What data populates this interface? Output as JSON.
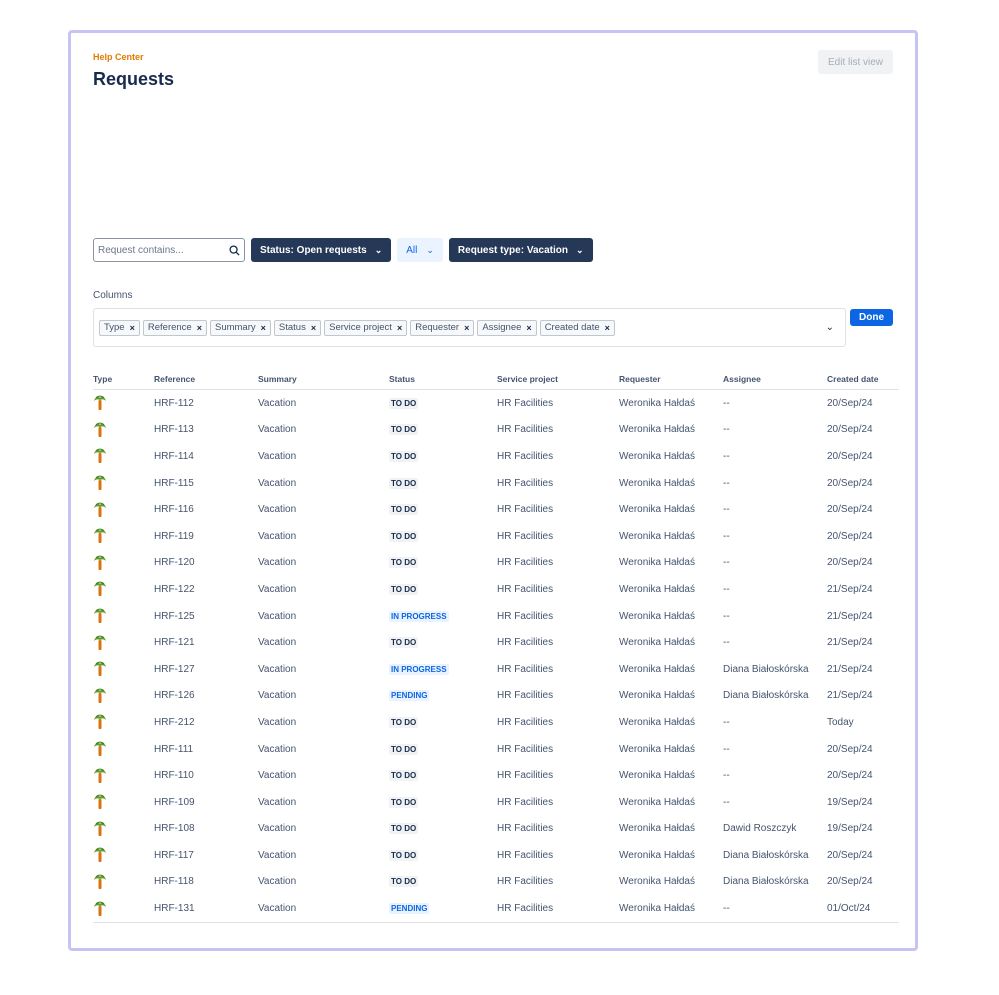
{
  "header": {
    "breadcrumb": "Help Center",
    "title": "Requests",
    "edit_button": "Edit list view"
  },
  "filters": {
    "search_placeholder": "Request contains...",
    "status_filter": "Status: Open requests",
    "all_filter": "All",
    "request_type_filter": "Request type: Vacation"
  },
  "columns_editor": {
    "label": "Columns",
    "tags": [
      "Type",
      "Reference",
      "Summary",
      "Status",
      "Service project",
      "Requester",
      "Assignee",
      "Created date"
    ],
    "done_button": "Done"
  },
  "table": {
    "headers": [
      "Type",
      "Reference",
      "Summary",
      "Status",
      "Service project",
      "Requester",
      "Assignee",
      "Created date"
    ],
    "rows": [
      {
        "type_icon": "palm-tree-icon",
        "reference": "HRF-112",
        "summary": "Vacation",
        "status": "TO DO",
        "project": "HR Facilities",
        "requester": "Weronika Hałdaś",
        "assignee": "--",
        "created": "20/Sep/24"
      },
      {
        "type_icon": "palm-tree-icon",
        "reference": "HRF-113",
        "summary": "Vacation",
        "status": "TO DO",
        "project": "HR Facilities",
        "requester": "Weronika Hałdaś",
        "assignee": "--",
        "created": "20/Sep/24"
      },
      {
        "type_icon": "palm-tree-icon",
        "reference": "HRF-114",
        "summary": "Vacation",
        "status": "TO DO",
        "project": "HR Facilities",
        "requester": "Weronika Hałdaś",
        "assignee": "--",
        "created": "20/Sep/24"
      },
      {
        "type_icon": "palm-tree-icon",
        "reference": "HRF-115",
        "summary": "Vacation",
        "status": "TO DO",
        "project": "HR Facilities",
        "requester": "Weronika Hałdaś",
        "assignee": "--",
        "created": "20/Sep/24"
      },
      {
        "type_icon": "palm-tree-icon",
        "reference": "HRF-116",
        "summary": "Vacation",
        "status": "TO DO",
        "project": "HR Facilities",
        "requester": "Weronika Hałdaś",
        "assignee": "--",
        "created": "20/Sep/24"
      },
      {
        "type_icon": "palm-tree-icon",
        "reference": "HRF-119",
        "summary": "Vacation",
        "status": "TO DO",
        "project": "HR Facilities",
        "requester": "Weronika Hałdaś",
        "assignee": "--",
        "created": "20/Sep/24"
      },
      {
        "type_icon": "palm-tree-icon",
        "reference": "HRF-120",
        "summary": "Vacation",
        "status": "TO DO",
        "project": "HR Facilities",
        "requester": "Weronika Hałdaś",
        "assignee": "--",
        "created": "20/Sep/24"
      },
      {
        "type_icon": "palm-tree-icon",
        "reference": "HRF-122",
        "summary": "Vacation",
        "status": "TO DO",
        "project": "HR Facilities",
        "requester": "Weronika Hałdaś",
        "assignee": "--",
        "created": "21/Sep/24"
      },
      {
        "type_icon": "palm-tree-icon",
        "reference": "HRF-125",
        "summary": "Vacation",
        "status": "IN PROGRESS",
        "project": "HR Facilities",
        "requester": "Weronika Hałdaś",
        "assignee": "--",
        "created": "21/Sep/24"
      },
      {
        "type_icon": "palm-tree-icon",
        "reference": "HRF-121",
        "summary": "Vacation",
        "status": "TO DO",
        "project": "HR Facilities",
        "requester": "Weronika Hałdaś",
        "assignee": "--",
        "created": "21/Sep/24"
      },
      {
        "type_icon": "palm-tree-icon",
        "reference": "HRF-127",
        "summary": "Vacation",
        "status": "IN PROGRESS",
        "project": "HR Facilities",
        "requester": "Weronika Hałdaś",
        "assignee": "Diana Białoskórska",
        "created": "21/Sep/24"
      },
      {
        "type_icon": "palm-tree-icon",
        "reference": "HRF-126",
        "summary": "Vacation",
        "status": "PENDING",
        "project": "HR Facilities",
        "requester": "Weronika Hałdaś",
        "assignee": "Diana Białoskórska",
        "created": "21/Sep/24"
      },
      {
        "type_icon": "palm-tree-icon",
        "reference": "HRF-212",
        "summary": "Vacation",
        "status": "TO DO",
        "project": "HR Facilities",
        "requester": "Weronika Hałdaś",
        "assignee": "--",
        "created": "Today"
      },
      {
        "type_icon": "palm-tree-icon",
        "reference": "HRF-111",
        "summary": "Vacation",
        "status": "TO DO",
        "project": "HR Facilities",
        "requester": "Weronika Hałdaś",
        "assignee": "--",
        "created": "20/Sep/24"
      },
      {
        "type_icon": "palm-tree-icon",
        "reference": "HRF-110",
        "summary": "Vacation",
        "status": "TO DO",
        "project": "HR Facilities",
        "requester": "Weronika Hałdaś",
        "assignee": "--",
        "created": "20/Sep/24"
      },
      {
        "type_icon": "palm-tree-icon",
        "reference": "HRF-109",
        "summary": "Vacation",
        "status": "TO DO",
        "project": "HR Facilities",
        "requester": "Weronika Hałdaś",
        "assignee": "--",
        "created": "19/Sep/24"
      },
      {
        "type_icon": "palm-tree-icon",
        "reference": "HRF-108",
        "summary": "Vacation",
        "status": "TO DO",
        "project": "HR Facilities",
        "requester": "Weronika Hałdaś",
        "assignee": "Dawid Roszczyk",
        "created": "19/Sep/24"
      },
      {
        "type_icon": "palm-tree-icon",
        "reference": "HRF-117",
        "summary": "Vacation",
        "status": "TO DO",
        "project": "HR Facilities",
        "requester": "Weronika Hałdaś",
        "assignee": "Diana Białoskórska",
        "created": "20/Sep/24"
      },
      {
        "type_icon": "palm-tree-icon",
        "reference": "HRF-118",
        "summary": "Vacation",
        "status": "TO DO",
        "project": "HR Facilities",
        "requester": "Weronika Hałdaś",
        "assignee": "Diana Białoskórska",
        "created": "20/Sep/24"
      },
      {
        "type_icon": "palm-tree-icon",
        "reference": "HRF-131",
        "summary": "Vacation",
        "status": "PENDING",
        "project": "HR Facilities",
        "requester": "Weronika Hałdaś",
        "assignee": "--",
        "created": "01/Oct/24"
      }
    ]
  },
  "colors": {
    "frame_border": "#c6c3f5",
    "breadcrumb": "#e07b00",
    "dark_pill": "#253858",
    "primary": "#0c66e4"
  }
}
